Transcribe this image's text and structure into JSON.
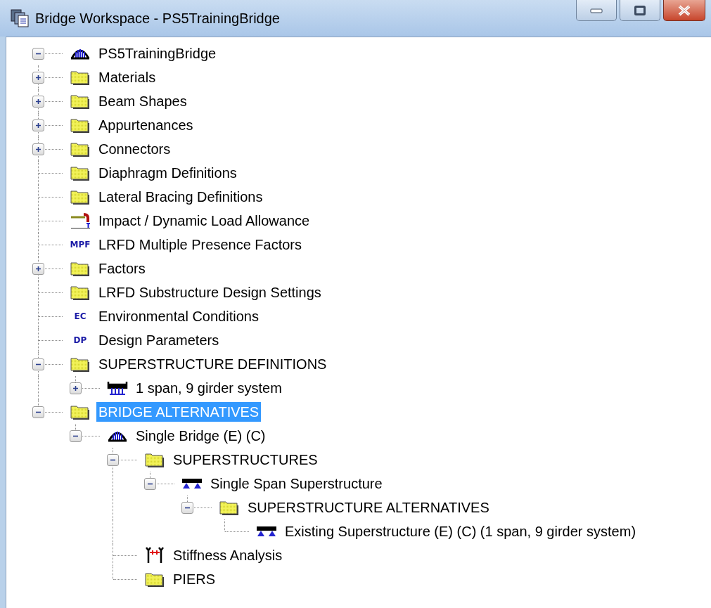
{
  "window": {
    "title": "Bridge Workspace - PS5TrainingBridge"
  },
  "tree": [
    {
      "label": "PS5TrainingBridge",
      "kind": "bridge",
      "expanded": true,
      "selected": false,
      "children": [
        {
          "label": "Materials",
          "kind": "folder",
          "expanded": false,
          "selected": false
        },
        {
          "label": "Beam Shapes",
          "kind": "folder",
          "expanded": false,
          "selected": false
        },
        {
          "label": "Appurtenances",
          "kind": "folder",
          "expanded": false,
          "selected": false
        },
        {
          "label": "Connectors",
          "kind": "folder",
          "expanded": false,
          "selected": false
        },
        {
          "label": "Diaphragm Definitions",
          "kind": "folder",
          "selected": false
        },
        {
          "label": "Lateral Bracing Definitions",
          "kind": "folder",
          "selected": false
        },
        {
          "label": "Impact / Dynamic Load Allowance",
          "kind": "impact",
          "selected": false
        },
        {
          "label": "LRFD Multiple Presence Factors",
          "kind": "badge",
          "badge": "MPF",
          "selected": false
        },
        {
          "label": "Factors",
          "kind": "folder",
          "expanded": false,
          "selected": false
        },
        {
          "label": "LRFD Substructure Design Settings",
          "kind": "folder",
          "selected": false
        },
        {
          "label": "Environmental Conditions",
          "kind": "badge",
          "badge": "EC",
          "selected": false
        },
        {
          "label": "Design Parameters",
          "kind": "badge",
          "badge": "DP",
          "selected": false
        },
        {
          "label": "SUPERSTRUCTURE DEFINITIONS",
          "kind": "folder",
          "expanded": true,
          "selected": false,
          "children": [
            {
              "label": "1 span, 9 girder system",
              "kind": "girders",
              "expanded": false,
              "selected": false
            }
          ]
        },
        {
          "label": "BRIDGE ALTERNATIVES",
          "kind": "folder",
          "expanded": true,
          "selected": true,
          "children": [
            {
              "label": "Single Bridge (E) (C)",
              "kind": "bridge",
              "expanded": true,
              "selected": false,
              "children": [
                {
                  "label": "SUPERSTRUCTURES",
                  "kind": "folder",
                  "expanded": true,
                  "selected": false,
                  "children": [
                    {
                      "label": "Single Span Superstructure",
                      "kind": "superstructure",
                      "expanded": true,
                      "selected": false,
                      "children": [
                        {
                          "label": "SUPERSTRUCTURE ALTERNATIVES",
                          "kind": "folder",
                          "expanded": true,
                          "selected": false,
                          "children": [
                            {
                              "label": "Existing Superstructure (E) (C) (1 span, 9 girder system)",
                              "kind": "superstructure",
                              "selected": false
                            }
                          ]
                        }
                      ]
                    }
                  ]
                },
                {
                  "label": "Stiffness Analysis",
                  "kind": "stiffness",
                  "selected": false
                },
                {
                  "label": "PIERS",
                  "kind": "folder",
                  "selected": false
                }
              ]
            }
          ]
        }
      ]
    }
  ]
}
